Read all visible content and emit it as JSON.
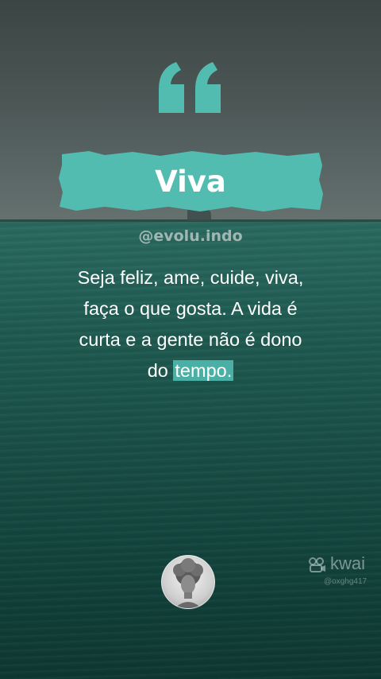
{
  "title": "Viva",
  "handle": "@evolu.indo",
  "quote": {
    "line1": "Seja feliz, ame, cuide, viva,",
    "line2": "faça o que gosta. A vida é",
    "line3": "curta e a gente não é dono",
    "line4_before": "do ",
    "line4_highlight": "tempo."
  },
  "watermark": {
    "brand": "kwai",
    "user": "@oxghg417"
  },
  "colors": {
    "accent": "#52bcb1",
    "highlight": "#4ab0a6",
    "text": "#ffffff"
  },
  "icons": {
    "quote_mark": "quote-mark-icon",
    "watermark_logo": "kwai-logo-icon"
  }
}
